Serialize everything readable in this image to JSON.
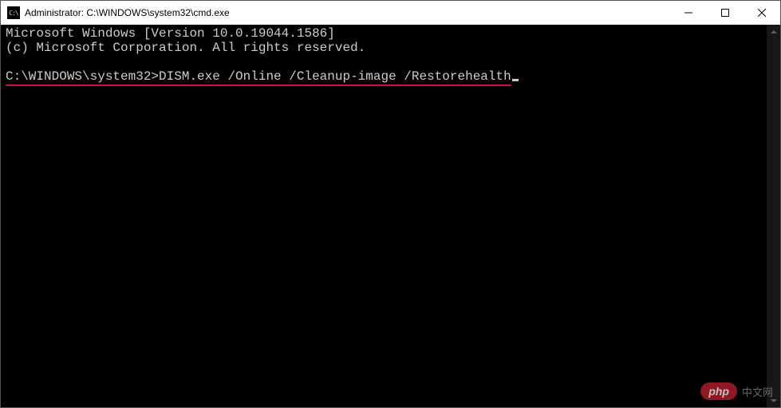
{
  "titlebar": {
    "title": "Administrator: C:\\WINDOWS\\system32\\cmd.exe"
  },
  "terminal": {
    "line1": "Microsoft Windows [Version 10.0.19044.1586]",
    "line2": "(c) Microsoft Corporation. All rights reserved.",
    "blank": "",
    "prompt": "C:\\WINDOWS\\system32>",
    "command": "DISM.exe /Online /Cleanup-image /Restorehealth"
  },
  "watermark": {
    "brand": "php",
    "text": "中文网"
  }
}
